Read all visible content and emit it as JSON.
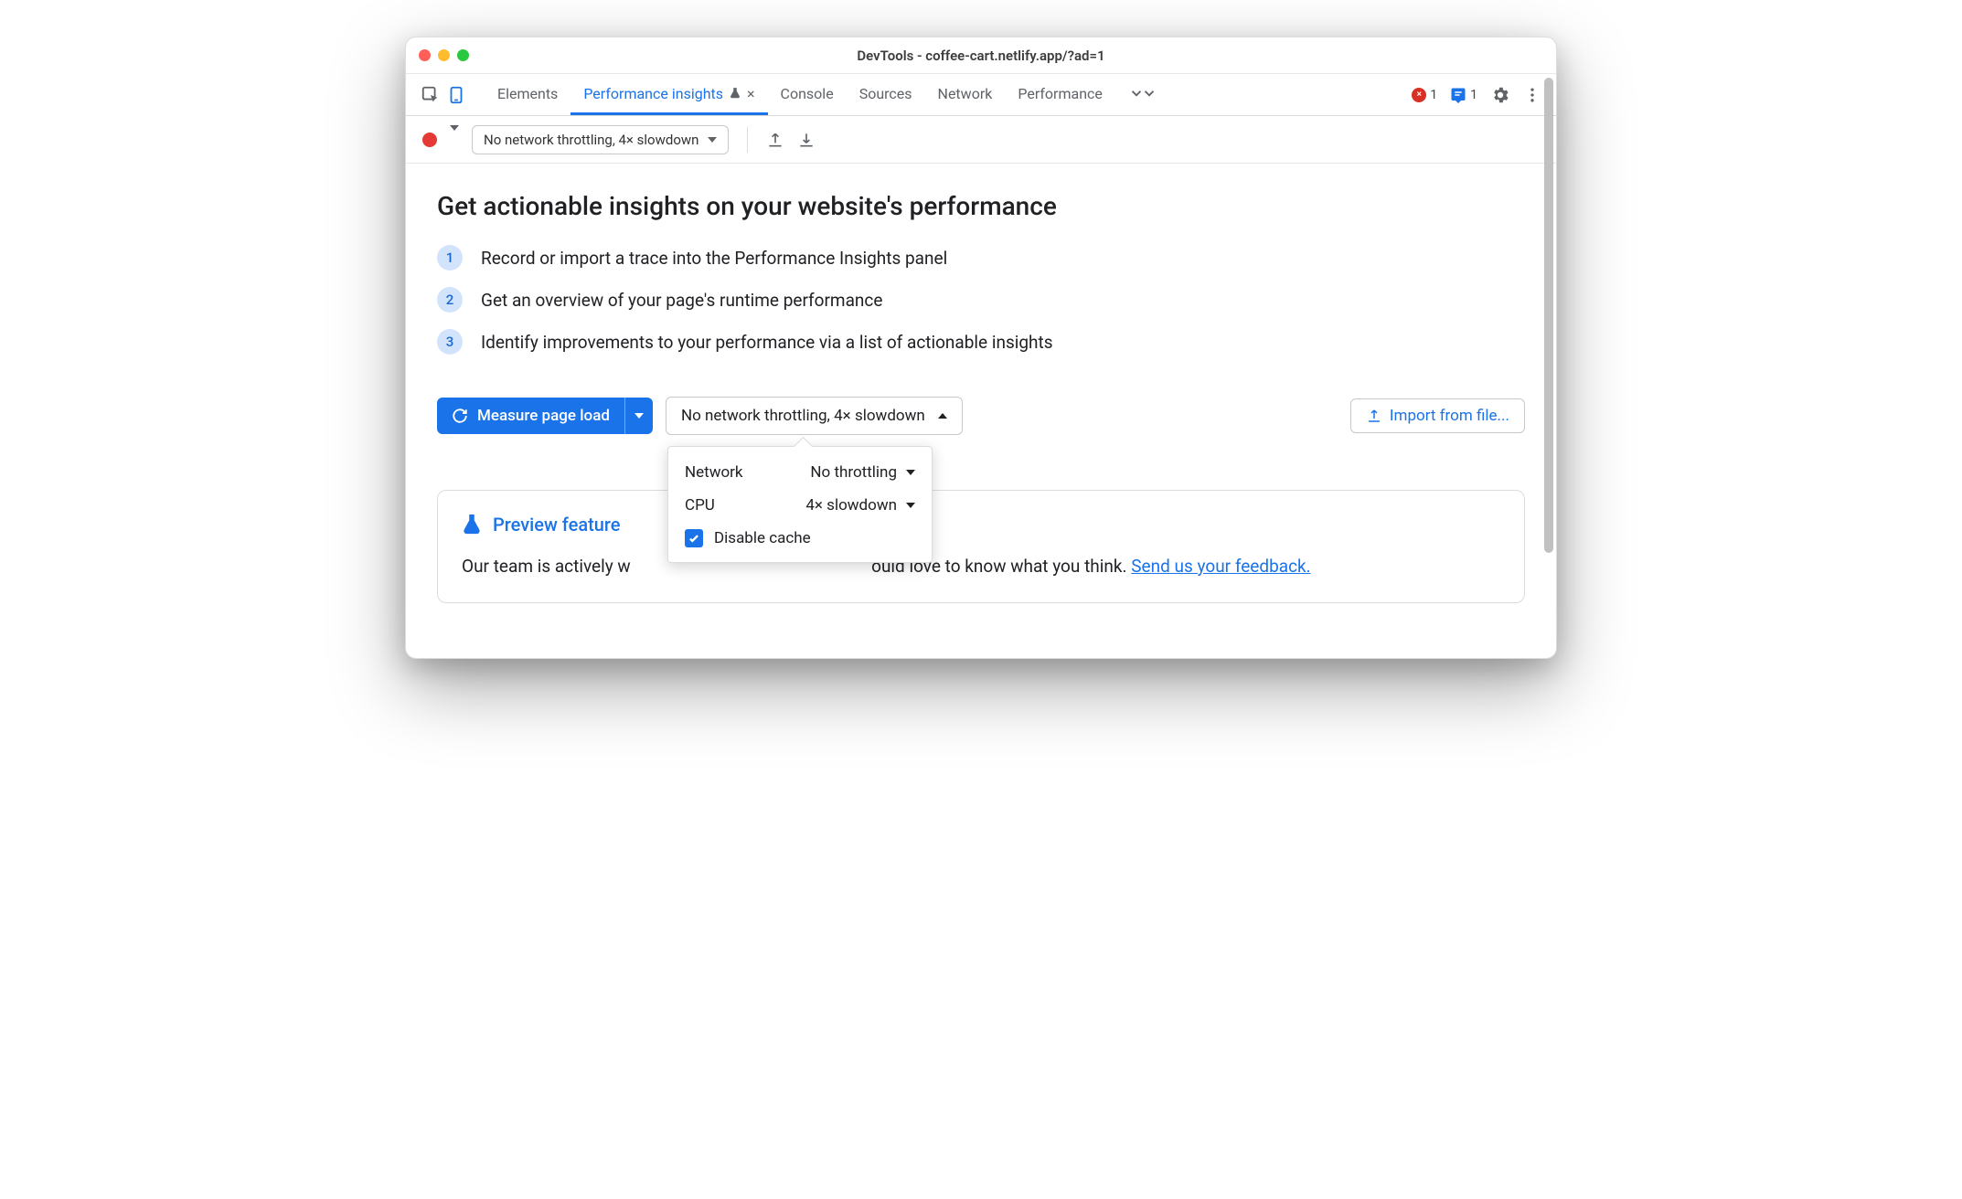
{
  "window": {
    "title": "DevTools - coffee-cart.netlify.app/?ad=1"
  },
  "tabs": {
    "items": [
      "Elements",
      "Performance insights",
      "Console",
      "Sources",
      "Network",
      "Performance"
    ],
    "active_index": 1,
    "errors_count": "1",
    "issues_count": "1"
  },
  "toolbar": {
    "throttle_summary": "No network throttling, 4× slowdown"
  },
  "main": {
    "heading": "Get actionable insights on your website's performance",
    "steps": [
      "Record or import a trace into the Performance Insights panel",
      "Get an overview of your page's runtime performance",
      "Identify improvements to your performance via a list of actionable insights"
    ],
    "measure_label": "Measure page load",
    "drop_label": "No network throttling, 4× slowdown",
    "import_label": "Import from file..."
  },
  "popover": {
    "network_label": "Network",
    "network_value": "No throttling",
    "cpu_label": "CPU",
    "cpu_value": "4× slowdown",
    "disable_cache_label": "Disable cache",
    "disable_cache_checked": true
  },
  "preview": {
    "title": "Preview feature",
    "body_prefix": "Our team is actively w",
    "body_mid": "ould love to know what you think. ",
    "link": "Send us your feedback."
  }
}
